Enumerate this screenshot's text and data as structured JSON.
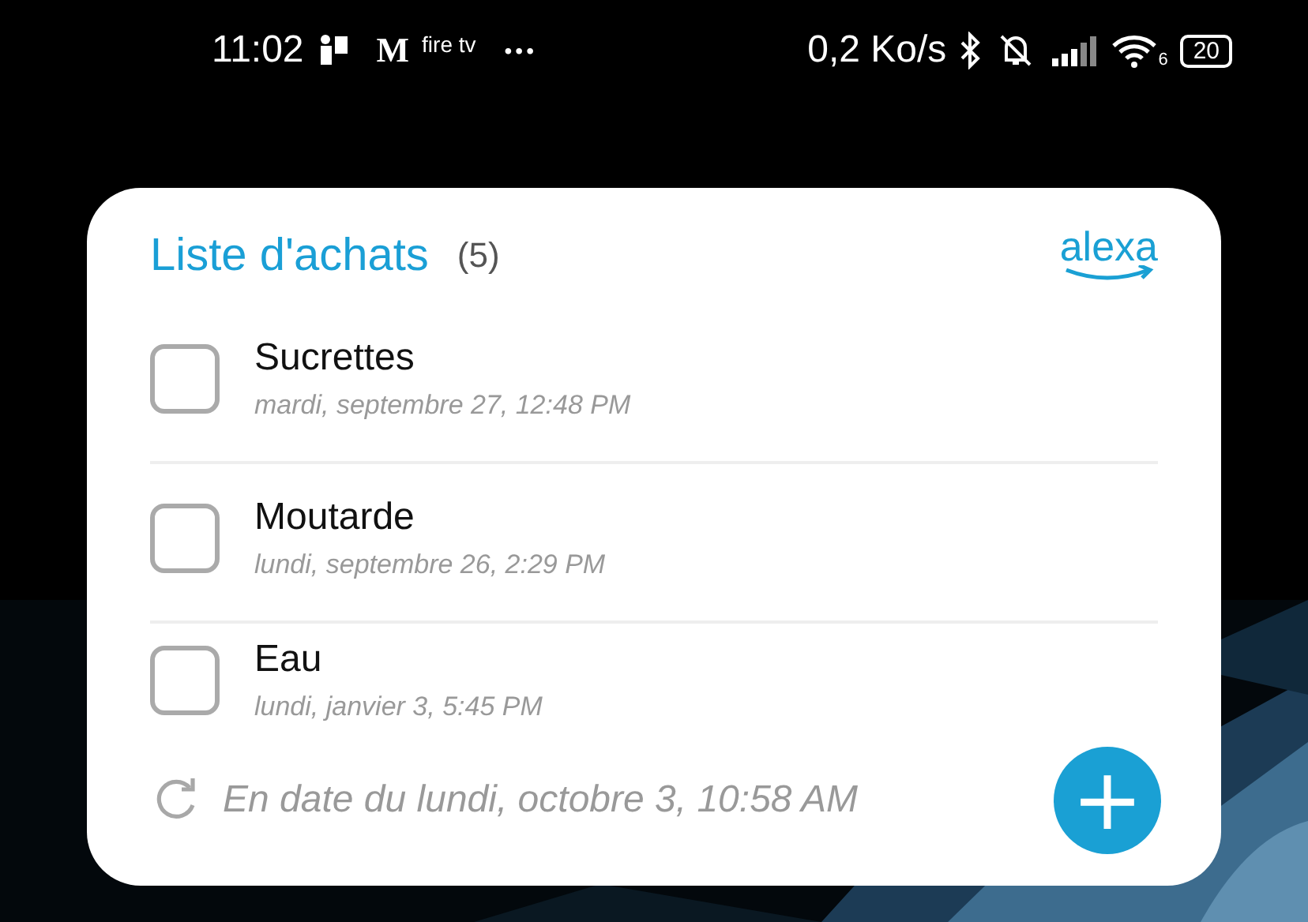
{
  "status_bar": {
    "time": "11:02",
    "notification_logos": [
      "M",
      "fire tv"
    ],
    "more": "•••",
    "speed": "0,2 Ko/s",
    "wifi_band": "6",
    "battery": "20"
  },
  "widget": {
    "title": "Liste d'achats",
    "count": "(5)",
    "logo": "alexa",
    "items": [
      {
        "name": "Sucrettes",
        "date": "mardi, septembre 27, 12:48 PM",
        "checked": false
      },
      {
        "name": "Moutarde",
        "date": "lundi, septembre 26, 2:29 PM",
        "checked": false
      },
      {
        "name": "Eau",
        "date": "lundi, janvier 3, 5:45 PM",
        "checked": false
      }
    ],
    "updated": "En date du lundi, octobre 3, 10:58 AM",
    "add_button": "+"
  }
}
